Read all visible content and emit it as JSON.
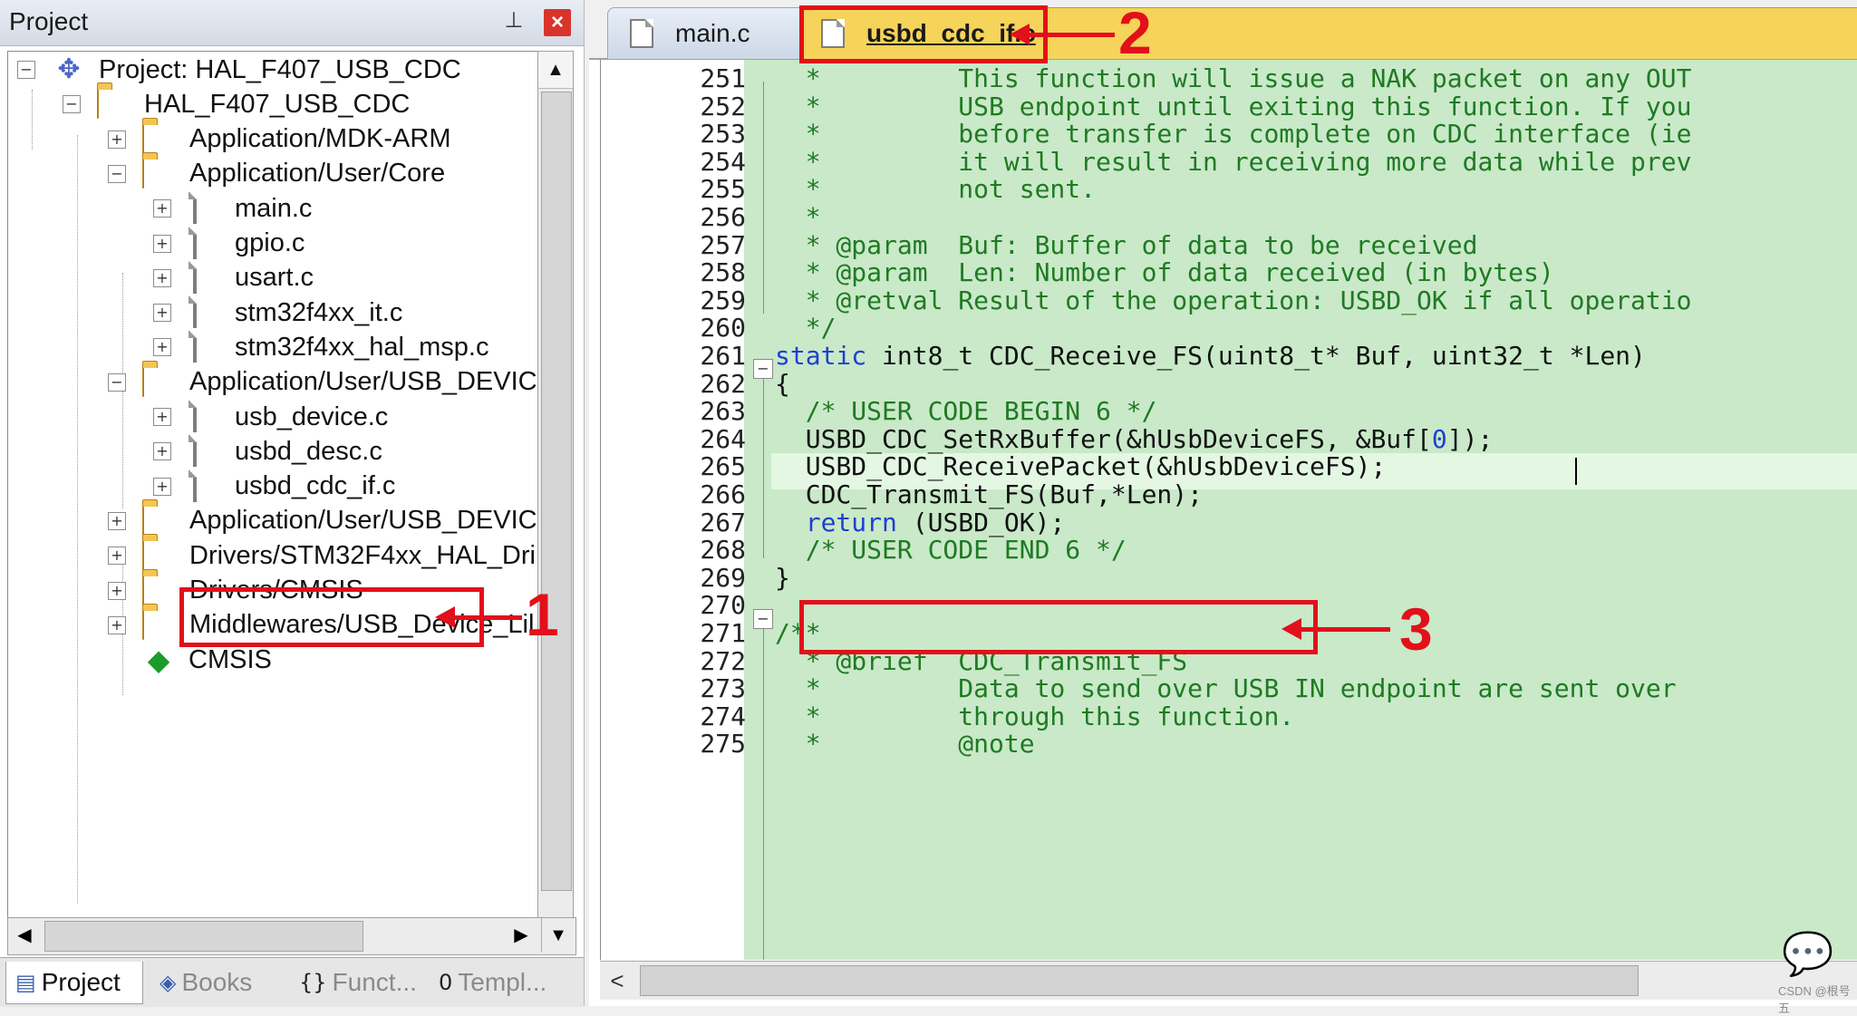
{
  "project_panel": {
    "title": "Project",
    "pin_icon": "pin-icon",
    "close_label": "×",
    "tree": [
      {
        "label": "Project: HAL_F407_USB_CDC",
        "icon": "project-icon",
        "expander": "−"
      },
      {
        "label": "HAL_F407_USB_CDC",
        "icon": "target-folder-icon",
        "expander": "−"
      },
      {
        "label": "Application/MDK-ARM",
        "icon": "folder-icon",
        "expander": "+"
      },
      {
        "label": "Application/User/Core",
        "icon": "folder-open-icon",
        "expander": "−"
      },
      {
        "label": "main.c",
        "icon": "file-icon",
        "expander": "+"
      },
      {
        "label": "gpio.c",
        "icon": "file-icon",
        "expander": "+"
      },
      {
        "label": "usart.c",
        "icon": "file-icon",
        "expander": "+"
      },
      {
        "label": "stm32f4xx_it.c",
        "icon": "file-icon",
        "expander": "+"
      },
      {
        "label": "stm32f4xx_hal_msp.c",
        "icon": "file-icon",
        "expander": "+"
      },
      {
        "label": "Application/User/USB_DEVIC",
        "icon": "folder-open-icon",
        "expander": "−"
      },
      {
        "label": "usb_device.c",
        "icon": "file-icon",
        "expander": "+"
      },
      {
        "label": "usbd_desc.c",
        "icon": "file-icon",
        "expander": "+"
      },
      {
        "label": "usbd_cdc_if.c",
        "icon": "file-icon",
        "expander": "+"
      },
      {
        "label": "Application/User/USB_DEVIC",
        "icon": "folder-icon",
        "expander": "+"
      },
      {
        "label": "Drivers/STM32F4xx_HAL_Dri",
        "icon": "folder-icon",
        "expander": "+"
      },
      {
        "label": "Drivers/CMSIS",
        "icon": "folder-icon",
        "expander": "+"
      },
      {
        "label": "Middlewares/USB_Device_Lil",
        "icon": "folder-icon",
        "expander": "+"
      },
      {
        "label": "CMSIS",
        "icon": "cmsis-icon",
        "expander": ""
      }
    ],
    "bottom_tabs": [
      {
        "label": "Project",
        "icon": "project-tab-icon",
        "glyph": "▤"
      },
      {
        "label": "Books",
        "icon": "books-icon",
        "glyph": "◈"
      },
      {
        "label": "Funct...",
        "icon": "functions-icon",
        "glyph": "{}"
      },
      {
        "label": "Templ...",
        "icon": "templates-icon",
        "glyph": "0"
      }
    ],
    "scroll": {
      "up": "▲",
      "left": "◀",
      "right": "▶",
      "down": "▼"
    }
  },
  "editor": {
    "tabs": [
      {
        "label": "main.c",
        "active": false
      },
      {
        "label": "usbd_cdc_if.c",
        "active": true
      }
    ],
    "lines": [
      {
        "n": "251",
        "parts": [
          {
            "t": "  *         This function will issue a NAK packet on any OUT",
            "c": "cmt"
          }
        ]
      },
      {
        "n": "252",
        "parts": [
          {
            "t": "  *         USB endpoint until exiting this function. If you",
            "c": "cmt"
          }
        ]
      },
      {
        "n": "253",
        "parts": [
          {
            "t": "  *         before transfer is complete on CDC interface (ie",
            "c": "cmt"
          }
        ]
      },
      {
        "n": "254",
        "parts": [
          {
            "t": "  *         it will result in receiving more data while prev",
            "c": "cmt"
          }
        ]
      },
      {
        "n": "255",
        "parts": [
          {
            "t": "  *         not sent.",
            "c": "cmt"
          }
        ]
      },
      {
        "n": "256",
        "parts": [
          {
            "t": "  *",
            "c": "cmt"
          }
        ]
      },
      {
        "n": "257",
        "parts": [
          {
            "t": "  * @param  Buf: Buffer of data to be received",
            "c": "cmt"
          }
        ]
      },
      {
        "n": "258",
        "parts": [
          {
            "t": "  * @param  Len: Number of data received (in bytes)",
            "c": "cmt"
          }
        ]
      },
      {
        "n": "259",
        "parts": [
          {
            "t": "  * @retval Result of the operation: USBD_OK if all operatio",
            "c": "cmt"
          }
        ]
      },
      {
        "n": "260",
        "parts": [
          {
            "t": "  */",
            "c": "cmt"
          }
        ]
      },
      {
        "n": "261",
        "parts": [
          {
            "t": "static",
            "c": "kw"
          },
          {
            "t": " int8_t CDC_Receive_FS(uint8_t* Buf, uint32_t *Len)",
            "c": ""
          }
        ]
      },
      {
        "n": "262",
        "parts": [
          {
            "t": "{",
            "c": ""
          }
        ]
      },
      {
        "n": "263",
        "parts": [
          {
            "t": "  /* USER CODE BEGIN 6 */",
            "c": "cmt"
          }
        ]
      },
      {
        "n": "264",
        "parts": [
          {
            "t": "  USBD_CDC_SetRxBuffer(&hUsbDeviceFS, &Buf[",
            "c": ""
          },
          {
            "t": "0",
            "c": "num"
          },
          {
            "t": "]);",
            "c": ""
          }
        ]
      },
      {
        "n": "265",
        "parts": [
          {
            "t": "  USBD_CDC_ReceivePacket(&hUsbDeviceFS);",
            "c": ""
          }
        ]
      },
      {
        "n": "266",
        "parts": [
          {
            "t": "  CDC_Transmit_FS(Buf,*Len);",
            "c": ""
          }
        ]
      },
      {
        "n": "267",
        "parts": [
          {
            "t": "  ",
            "c": ""
          },
          {
            "t": "return",
            "c": "kw"
          },
          {
            "t": " (USBD_OK);",
            "c": ""
          }
        ]
      },
      {
        "n": "268",
        "parts": [
          {
            "t": "  /* USER CODE END 6 */",
            "c": "cmt"
          }
        ]
      },
      {
        "n": "269",
        "parts": [
          {
            "t": "}",
            "c": ""
          }
        ]
      },
      {
        "n": "270",
        "parts": [
          {
            "t": "",
            "c": ""
          }
        ]
      },
      {
        "n": "271",
        "parts": [
          {
            "t": "/**",
            "c": "cmt"
          }
        ]
      },
      {
        "n": "272",
        "parts": [
          {
            "t": "  * @brief  CDC_Transmit_FS",
            "c": "cmt"
          }
        ]
      },
      {
        "n": "273",
        "parts": [
          {
            "t": "  *         Data to send over USB IN endpoint are sent over",
            "c": "cmt"
          }
        ]
      },
      {
        "n": "274",
        "parts": [
          {
            "t": "  *         through this function.",
            "c": "cmt"
          }
        ]
      },
      {
        "n": "275",
        "parts": [
          {
            "t": "  *         @note",
            "c": "cmt"
          }
        ]
      }
    ],
    "scroll_left": "<"
  },
  "annotations": [
    {
      "label": "1",
      "target": "usbd_cdc_if.c in project tree"
    },
    {
      "label": "2",
      "target": "usbd_cdc_if.c editor tab"
    },
    {
      "label": "3",
      "target": "CDC_Transmit_FS(Buf,*Len); line"
    }
  ],
  "watermark": "CSDN @根号五",
  "colors": {
    "comment": "#1f7a22",
    "keyword": "#1f3fd0",
    "code_bg": "#c9e9c9",
    "annotation": "#e2101a",
    "active_tab": "#f6d35a"
  }
}
